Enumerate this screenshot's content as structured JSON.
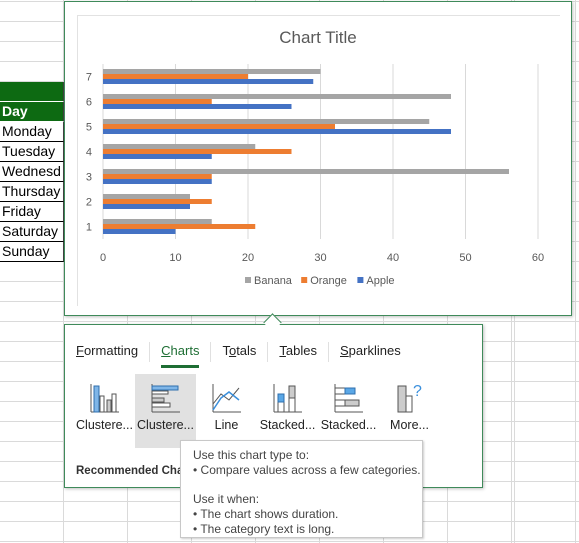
{
  "sheet": {
    "header_label": "Day",
    "days": [
      "Monday",
      "Tuesday",
      "Wednesd",
      "Thursday",
      "Friday",
      "Saturday",
      "Sunday"
    ]
  },
  "chart_data": {
    "type": "bar",
    "orientation": "horizontal",
    "title": "Chart Title",
    "categories": [
      "1",
      "2",
      "3",
      "4",
      "5",
      "6",
      "7"
    ],
    "series": [
      {
        "name": "Apple",
        "color": "#4472c4",
        "values": [
          10,
          12,
          15,
          15,
          48,
          26,
          29
        ]
      },
      {
        "name": "Orange",
        "color": "#ed7d31",
        "values": [
          21,
          15,
          15,
          26,
          32,
          15,
          20
        ]
      },
      {
        "name": "Banana",
        "color": "#a5a5a5",
        "values": [
          15,
          12,
          56,
          21,
          45,
          48,
          30
        ]
      }
    ],
    "xlim": [
      0,
      60
    ],
    "xticks": [
      "0",
      "10",
      "20",
      "30",
      "40",
      "50",
      "60"
    ],
    "grid": true,
    "legend": "bottom",
    "legend_order": [
      "Banana",
      "Orange",
      "Apple"
    ]
  },
  "quick_analysis": {
    "tabs": [
      {
        "label": "Formatting",
        "underline": "F",
        "active": false
      },
      {
        "label": "Charts",
        "underline": "C",
        "active": true
      },
      {
        "label": "Totals",
        "underline": "o",
        "active": false
      },
      {
        "label": "Tables",
        "underline": "T",
        "active": false
      },
      {
        "label": "Sparklines",
        "underline": "S",
        "active": false
      }
    ],
    "options": [
      {
        "label": "Clustere...",
        "icon": "clustered-column-icon"
      },
      {
        "label": "Clustere...",
        "icon": "clustered-bar-icon",
        "selected": true
      },
      {
        "label": "Line",
        "icon": "line-chart-icon"
      },
      {
        "label": "Stacked...",
        "icon": "stacked-column-icon"
      },
      {
        "label": "Stacked...",
        "icon": "stacked-bar-icon"
      },
      {
        "label": "More...",
        "icon": "more-charts-icon"
      }
    ],
    "footer": "Recommended Char"
  },
  "tooltip": {
    "line1": "Use this chart type to:",
    "line2": "• Compare values across a few categories.",
    "line3": "Use it when:",
    "line4": "• The chart shows duration.",
    "line5": "• The category text is long."
  },
  "accent_color": "#1e6e34"
}
